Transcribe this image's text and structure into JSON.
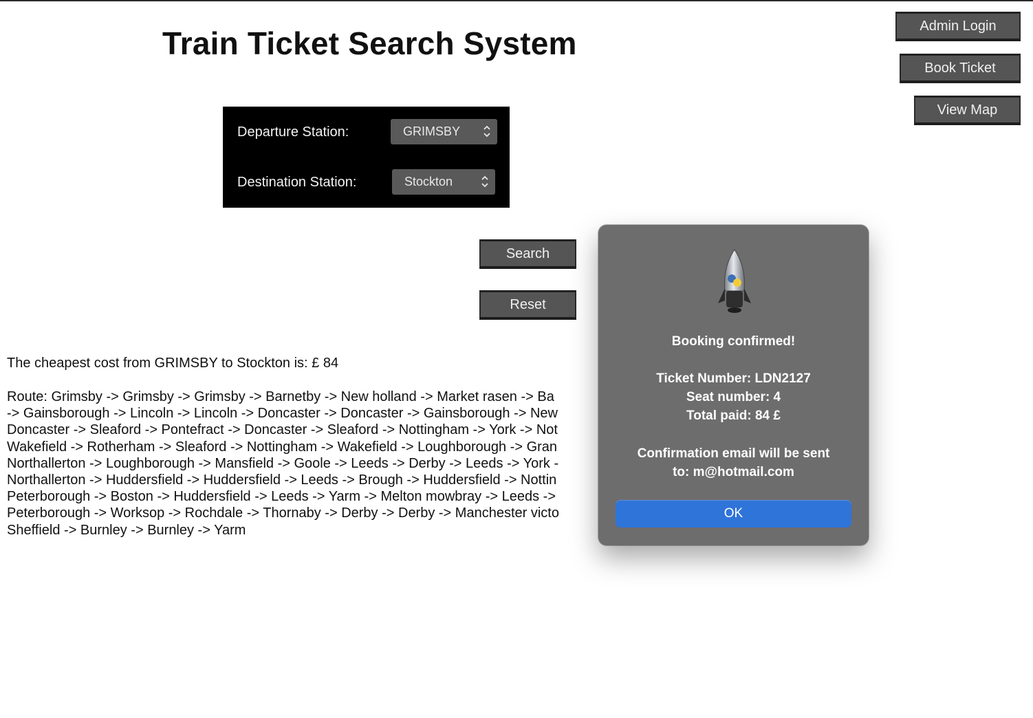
{
  "window": {
    "title": "Train Ticket Search System"
  },
  "header_buttons": {
    "admin_login": "Admin Login",
    "book_ticket": "Book Ticket",
    "view_map": "View Map"
  },
  "station_form": {
    "departure_label": "Departure Station:",
    "departure_value": "GRIMSBY",
    "destination_label": "Destination Station:",
    "destination_value": "Stockton"
  },
  "actions": {
    "search": "Search",
    "reset": "Reset"
  },
  "result": {
    "cheapest": "The cheapest cost from GRIMSBY to Stockton is: £ 84",
    "route_lines": [
      " Route: Grimsby -> Grimsby -> Grimsby -> Barnetby -> New holland -> Market rasen -> Ba",
      "-> Gainsborough -> Lincoln -> Lincoln -> Doncaster -> Doncaster -> Gainsborough -> New",
      "Doncaster -> Sleaford -> Pontefract -> Doncaster -> Sleaford -> Nottingham -> York -> Not",
      "Wakefield -> Rotherham -> Sleaford -> Nottingham -> Wakefield -> Loughborough -> Gran",
      "Northallerton -> Loughborough -> Mansfield -> Goole -> Leeds -> Derby -> Leeds -> York -",
      "Northallerton -> Huddersfield -> Huddersfield -> Leeds -> Brough -> Huddersfield -> Nottin",
      "Peterborough -> Boston -> Huddersfield -> Leeds -> Yarm -> Melton mowbray -> Leeds ->",
      "Peterborough -> Worksop -> Rochdale -> Thornaby -> Derby -> Derby -> Manchester victo",
      "Sheffield -> Burnley -> Burnley -> Yarm"
    ]
  },
  "dialog": {
    "icon": "python-rocket-icon",
    "heading": "Booking confirmed!",
    "ticket_number": "Ticket Number: LDN2127",
    "seat_number": "Seat number: 4",
    "total_paid": "Total paid: 84 £",
    "email_line1": "Confirmation email will be sent",
    "email_line2": "to: m@hotmail.com",
    "ok": "OK"
  },
  "colors": {
    "button_bg": "#555555",
    "station_box_bg": "#000000",
    "dialog_bg": "#6d6d6d",
    "ok_button": "#2f74d9"
  }
}
